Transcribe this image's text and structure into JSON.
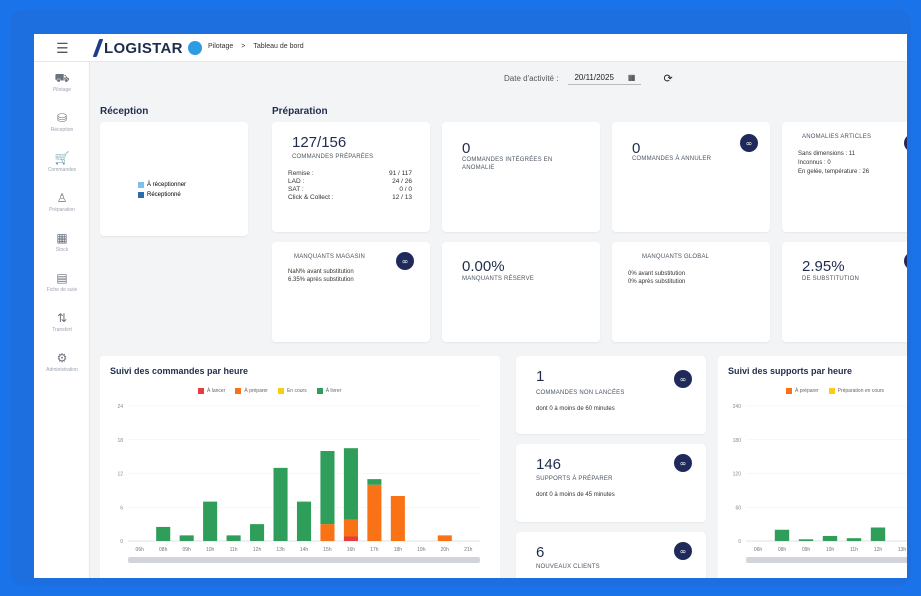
{
  "topbar": {
    "logo_text": "LOGISTAR",
    "breadcrumb": [
      "Pilotage",
      ">",
      "Tableau de bord"
    ]
  },
  "sidebar": {
    "items": [
      {
        "icon": "truck-icon",
        "glyph": "⛟",
        "label": "Pilotage"
      },
      {
        "icon": "basket-icon",
        "glyph": "⛁",
        "label": "Réception"
      },
      {
        "icon": "cart-icon",
        "glyph": "🛒",
        "label": "Commandes"
      },
      {
        "icon": "person-icon",
        "glyph": "♙",
        "label": "Préparation"
      },
      {
        "icon": "stock-icon",
        "glyph": "▦",
        "label": "Stock"
      },
      {
        "icon": "file-icon",
        "glyph": "▤",
        "label": "Fiche de suivi"
      },
      {
        "icon": "arrows-icon",
        "glyph": "⇅",
        "label": "Transfert"
      },
      {
        "icon": "gear-icon",
        "glyph": "⚙",
        "label": "Administration"
      }
    ]
  },
  "date": {
    "label": "Date d'activité :",
    "value": "20/11/2025",
    "calendar_icon": "calendar-icon",
    "refresh_icon": "refresh-icon"
  },
  "reception": {
    "title": "Réception",
    "legend": [
      "À réceptionner",
      "Réceptionné"
    ],
    "colors": [
      "#7fbfea",
      "#2b6cb0"
    ]
  },
  "preparation": {
    "title": "Préparation",
    "prepared": {
      "value": "127/156",
      "label": "COMMANDES PRÉPARÉES",
      "rows": [
        {
          "k": "Remise :",
          "v": "91 / 117"
        },
        {
          "k": "LAD :",
          "v": "24 / 26"
        },
        {
          "k": "SAT :",
          "v": "0 / 0"
        },
        {
          "k": "Click & Collect :",
          "v": "12 / 13"
        }
      ]
    },
    "integrated": {
      "value": "0",
      "label": "COMMANDES INTÉGRÉES EN ANOMALIE"
    },
    "to_cancel": {
      "value": "0",
      "label": "COMMANDES À ANNULER"
    },
    "anomalies": {
      "title": "ANOMALIES ARTICLES",
      "lines": [
        "Sans dimensions : 11",
        "Inconnus : 0",
        "En gelée, température : 26"
      ]
    },
    "missing_store": {
      "title": "MANQUANTS MAGASIN",
      "lines": [
        "NaN% avant substitution",
        "6.35% après substitution"
      ]
    },
    "missing_reserve": {
      "value": "0.00%",
      "label": "MANQUANTS RÉSERVE"
    },
    "missing_global": {
      "title": "MANQUANTS GLOBAL",
      "lines": [
        "0% avant substitution",
        "0% après substitution"
      ]
    },
    "substitution": {
      "value": "2.95%",
      "label": "DE SUBSTITUTION"
    }
  },
  "orders_chart": {
    "title": "Suivi des commandes par heure",
    "legend": [
      "À lancer",
      "À préparer",
      "En cours",
      "À livrer"
    ],
    "colors": [
      "#e53e3e",
      "#f97316",
      "#facc15",
      "#2f9e5a"
    ]
  },
  "chart_data": [
    {
      "type": "bar",
      "title": "Suivi des commandes par heure",
      "stacked": true,
      "categories": [
        "06h",
        "08h",
        "09h",
        "10h",
        "11h",
        "12h",
        "13h",
        "14h",
        "15h",
        "16h",
        "17h",
        "18h",
        "19h",
        "20h",
        "21h"
      ],
      "ylim": [
        0,
        24
      ],
      "yticks": [
        0,
        6,
        12,
        18,
        24
      ],
      "series": [
        {
          "name": "À lancer",
          "values": [
            0,
            0,
            0,
            0,
            0,
            0,
            0,
            0,
            0,
            0.8,
            0,
            0,
            0,
            0,
            0
          ]
        },
        {
          "name": "À préparer",
          "values": [
            0,
            0,
            0,
            0,
            0,
            0,
            0,
            0,
            3,
            3,
            10,
            8,
            0,
            1,
            0
          ]
        },
        {
          "name": "En cours",
          "values": [
            0,
            0,
            0,
            0,
            0,
            0,
            0,
            0,
            0,
            0,
            0,
            0,
            0,
            0,
            0
          ]
        },
        {
          "name": "À livrer",
          "values": [
            0,
            2.5,
            1,
            7,
            1,
            3,
            13,
            7,
            13,
            12.7,
            1,
            0,
            0,
            0,
            0
          ]
        }
      ]
    },
    {
      "type": "bar",
      "title": "Suivi des supports par heure",
      "stacked": true,
      "categories": [
        "06h",
        "08h",
        "09h",
        "10h",
        "11h",
        "12h",
        "13h"
      ],
      "ylim": [
        0,
        240
      ],
      "yticks": [
        0,
        60,
        120,
        180,
        240
      ],
      "series": [
        {
          "name": "À préparer",
          "values": [
            0,
            0,
            0,
            0,
            0,
            0,
            0
          ]
        },
        {
          "name": "Préparation en cours",
          "values": [
            0,
            0,
            0,
            0,
            0,
            0,
            0
          ]
        },
        {
          "name": "",
          "values": [
            0,
            20,
            3,
            9,
            5,
            24,
            0
          ]
        }
      ]
    }
  ],
  "alerts": [
    {
      "value": "1",
      "label": "COMMANDES NON LANCÉES",
      "note": "dont 0 à moins de 60 minutes"
    },
    {
      "value": "146",
      "label": "SUPPORTS À PRÉPARER",
      "note": "dont 0 à moins de 45 minutes"
    },
    {
      "value": "6",
      "label": "NOUVEAUX CLIENTS",
      "note": ""
    }
  ],
  "supports_chart": {
    "title": "Suivi des supports par heure",
    "legend": [
      "À préparer",
      "Préparation en cours"
    ],
    "colors": [
      "#f97316",
      "#facc15",
      "#2f9e5a"
    ]
  }
}
